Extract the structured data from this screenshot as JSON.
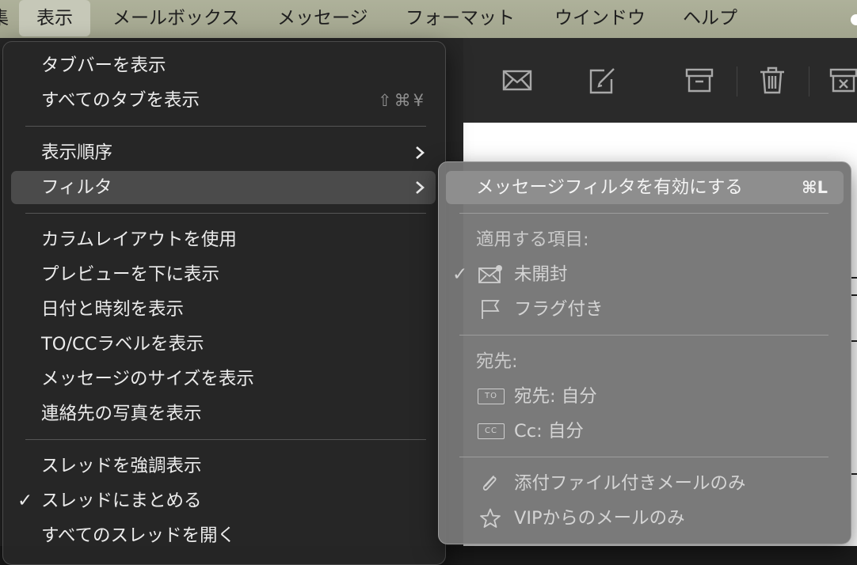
{
  "menubar": {
    "partial_left": "集",
    "items": [
      "表示",
      "メールボックス",
      "メッセージ",
      "フォーマット",
      "ウインドウ",
      "ヘルプ"
    ]
  },
  "view_menu": {
    "items": [
      {
        "label": "タブバーを表示"
      },
      {
        "label": "すべてのタブを表示",
        "shortcut": "⇧⌘¥"
      },
      {
        "label": "表示順序"
      },
      {
        "label": "フィルタ"
      },
      {
        "label": "カラムレイアウトを使用"
      },
      {
        "label": "プレビューを下に表示"
      },
      {
        "label": "日付と時刻を表示"
      },
      {
        "label": "TO/CCラベルを表示"
      },
      {
        "label": "メッセージのサイズを表示"
      },
      {
        "label": "連絡先の写真を表示"
      },
      {
        "label": "スレッドを強調表示"
      },
      {
        "label": "スレッドにまとめる",
        "checked": "✓"
      },
      {
        "label": "すべてのスレッドを開く"
      }
    ]
  },
  "filter_submenu": {
    "enable_label": "メッセージフィルタを有効にする",
    "enable_shortcut": "⌘L",
    "apply_header": "適用する項目:",
    "unread_label": "未開封",
    "unread_check": "✓",
    "flagged_label": "フラグ付き",
    "recipient_header": "宛先:",
    "to_tag": "TO",
    "to_me_label": "宛先: 自分",
    "cc_tag": "CC",
    "cc_me_label": "Cc: 自分",
    "attachments_label": "添付ファイル付きメールのみ",
    "vip_label": "VIPからのメールのみ"
  },
  "colors": {
    "menubar": "#aeb19a",
    "menu_bg": "#262626",
    "submenu_bg": "#767676",
    "highlight": "#4b4b4b"
  }
}
